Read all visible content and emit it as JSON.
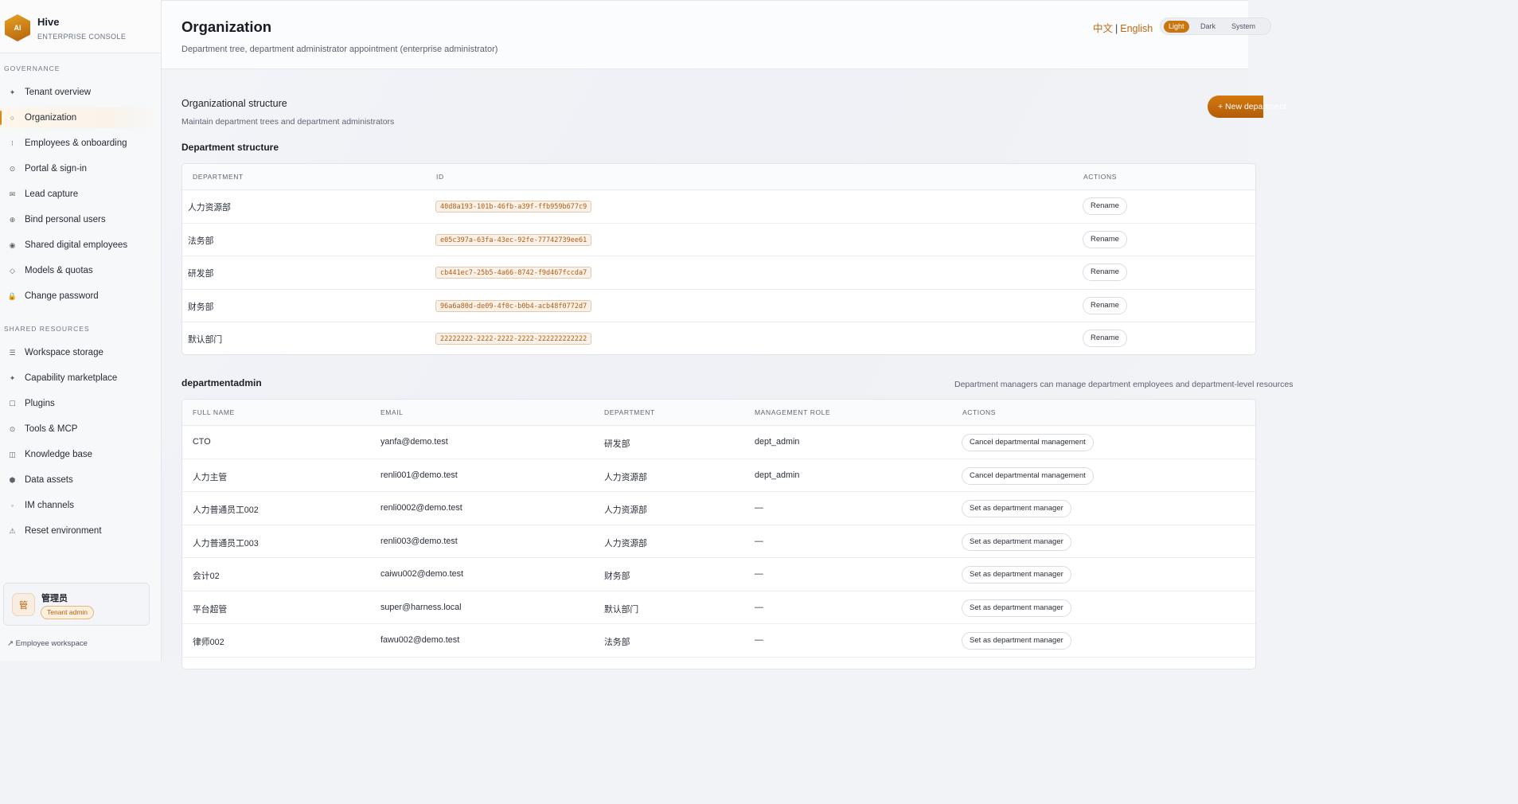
{
  "brand": {
    "logo_text": "AI",
    "name": "Hive",
    "subtitle": "ENTERPRISE CONSOLE",
    "accent": "#c9760f"
  },
  "sidebar": {
    "sections": [
      {
        "title": "GOVERNANCE",
        "items": [
          {
            "label": "Tenant overview",
            "icon": "✦",
            "icon_name": "sparkle-icon"
          },
          {
            "label": "Organization",
            "icon": "○",
            "icon_name": "circle-icon",
            "active": true
          },
          {
            "label": "Employees & onboarding",
            "icon": "⁝",
            "icon_name": "users-icon"
          },
          {
            "label": "Portal & sign-in",
            "icon": "⊙",
            "icon_name": "portal-icon"
          },
          {
            "label": "Lead capture",
            "icon": "✉",
            "icon_name": "mail-icon"
          },
          {
            "label": "Bind personal users",
            "icon": "⊕",
            "icon_name": "link-user-icon"
          },
          {
            "label": "Shared digital employees",
            "icon": "◉",
            "icon_name": "digital-employee-icon"
          },
          {
            "label": "Models & quotas",
            "icon": "◇",
            "icon_name": "model-icon"
          },
          {
            "label": "Change password",
            "icon": "🔒",
            "icon_name": "lock-icon"
          }
        ]
      },
      {
        "title": "SHARED RESOURCES",
        "items": [
          {
            "label": "Workspace storage",
            "icon": "☰",
            "icon_name": "storage-icon"
          },
          {
            "label": "Capability marketplace",
            "icon": "✦",
            "icon_name": "marketplace-icon"
          },
          {
            "label": "Plugins",
            "icon": "☐",
            "icon_name": "plugin-icon"
          },
          {
            "label": "Tools & MCP",
            "icon": "⊙",
            "icon_name": "tools-icon"
          },
          {
            "label": "Knowledge base",
            "icon": "◫",
            "icon_name": "book-icon"
          },
          {
            "label": "Data assets",
            "icon": "⬢",
            "icon_name": "database-icon"
          },
          {
            "label": "IM channels",
            "icon": "◦",
            "icon_name": "chat-icon"
          },
          {
            "label": "Reset environment",
            "icon": "⚠",
            "icon_name": "warning-icon"
          }
        ]
      }
    ],
    "user": {
      "avatar": "管",
      "name": "管理员",
      "role": "Tenant admin"
    },
    "workspace_link": "↗ Employee workspace"
  },
  "header": {
    "title": "Organization",
    "subtitle": "Department tree, department administrator appointment (enterprise administrator)",
    "lang_zh": "中文",
    "lang_sep": "|",
    "lang_en": "English",
    "theme": {
      "light": "Light",
      "dark": "Dark",
      "system": "System"
    }
  },
  "org": {
    "title": "Organizational structure",
    "subtitle": "Maintain department trees and department administrators",
    "new_button": "+ New department"
  },
  "departments": {
    "heading": "Department structure",
    "columns": [
      "DEPARTMENT",
      "ID",
      "ACTIONS"
    ],
    "rows": [
      {
        "name": "人力资源部",
        "id": "40d8a193-101b-46fb-a39f-ffb959b677c9",
        "action": "Rename"
      },
      {
        "name": "法务部",
        "id": "e05c397a-63fa-43ec-92fe-77742739ee61",
        "action": "Rename"
      },
      {
        "name": "研发部",
        "id": "cb441ec7-25b5-4a66-8742-f9d467fccda7",
        "action": "Rename"
      },
      {
        "name": "财务部",
        "id": "96a6a80d-de09-4f0c-b0b4-acb48f0772d7",
        "action": "Rename"
      },
      {
        "name": "默认部门",
        "id": "22222222-2222-2222-2222-222222222222",
        "action": "Rename"
      }
    ]
  },
  "admins": {
    "heading": "departmentadmin",
    "note": "Department managers can manage department employees and department-level resources",
    "columns": [
      "FULL NAME",
      "EMAIL",
      "DEPARTMENT",
      "MANAGEMENT ROLE",
      "ACTIONS"
    ],
    "rows": [
      {
        "name": "CTO",
        "email": "yanfa@demo.test",
        "dept": "研发部",
        "role": "dept_admin",
        "action": "Cancel departmental management"
      },
      {
        "name": "人力主管",
        "email": "renli001@demo.test",
        "dept": "人力资源部",
        "role": "dept_admin",
        "action": "Cancel departmental management"
      },
      {
        "name": "人力普通员工002",
        "email": "renli0002@demo.test",
        "dept": "人力资源部",
        "role": "—",
        "action": "Set as department manager"
      },
      {
        "name": "人力普通员工003",
        "email": "renli003@demo.test",
        "dept": "人力资源部",
        "role": "—",
        "action": "Set as department manager"
      },
      {
        "name": "会计02",
        "email": "caiwu002@demo.test",
        "dept": "财务部",
        "role": "—",
        "action": "Set as department manager"
      },
      {
        "name": "平台超管",
        "email": "super@harness.local",
        "dept": "默认部门",
        "role": "—",
        "action": "Set as department manager"
      },
      {
        "name": "律师002",
        "email": "fawu002@demo.test",
        "dept": "法务部",
        "role": "—",
        "action": "Set as department manager"
      }
    ]
  }
}
